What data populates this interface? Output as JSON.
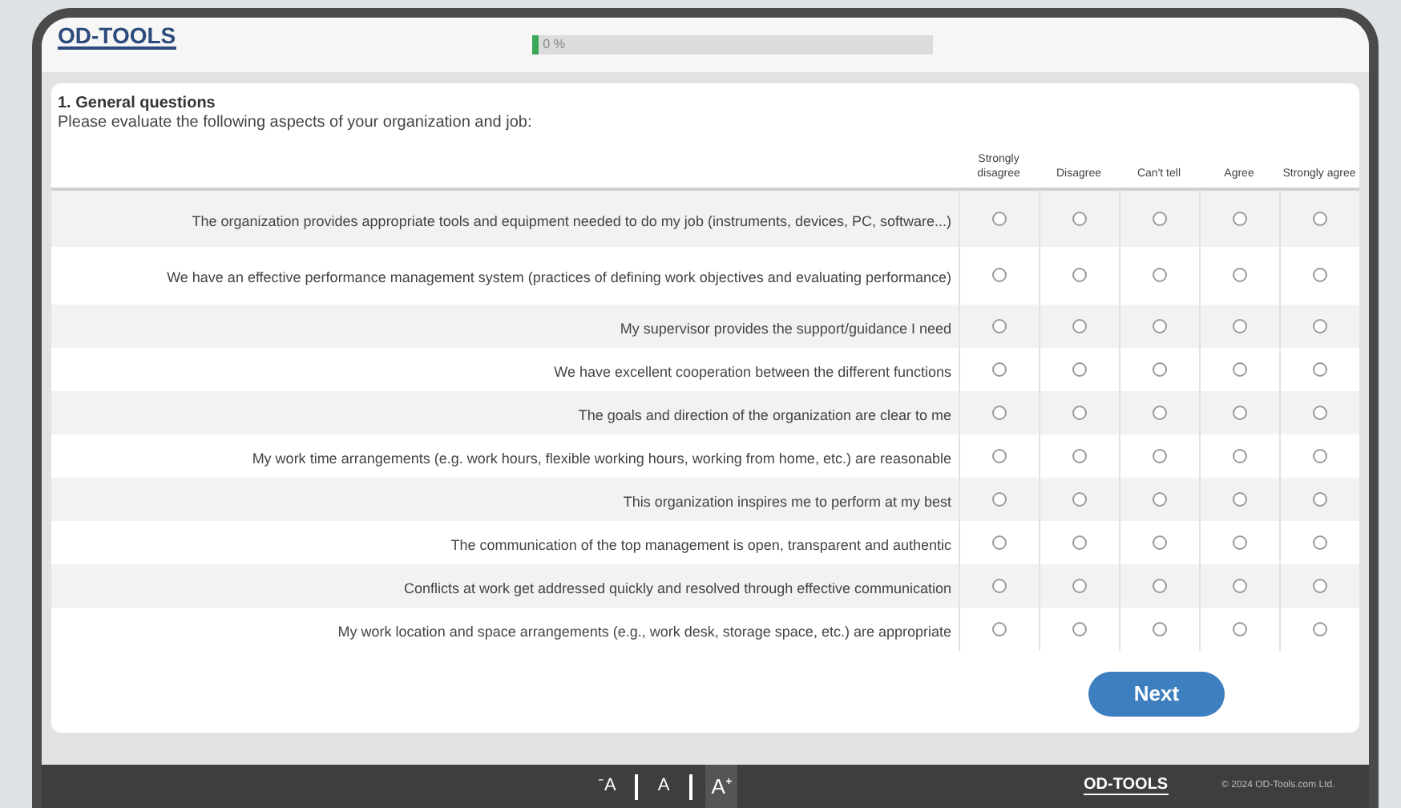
{
  "header": {
    "logo": "OD-TOOLS",
    "progress": {
      "level": 0,
      "label": "0 %"
    }
  },
  "section": {
    "title": "1. General questions",
    "instruction": "Please evaluate the following aspects of your organization and job:"
  },
  "table": {
    "columns": [
      "Strongly disagree",
      "Disagree",
      "Can't tell",
      "Agree",
      "Strongly agree"
    ],
    "rows": [
      {
        "question": "The organization provides appropriate tools and equipment needed to do my job (instruments, devices, PC, software...)",
        "choices": [
          {
            "selected": false
          },
          {
            "selected": false
          },
          {
            "selected": false
          },
          {
            "selected": false
          },
          {
            "selected": false
          }
        ]
      },
      {
        "question": "We have an effective performance management system (practices of defining work objectives and evaluating performance)",
        "choices": [
          {
            "selected": false
          },
          {
            "selected": false
          },
          {
            "selected": false
          },
          {
            "selected": false
          },
          {
            "selected": false
          }
        ]
      },
      {
        "question": "My supervisor provides the support/guidance I need",
        "choices": [
          {
            "selected": false
          },
          {
            "selected": false
          },
          {
            "selected": false
          },
          {
            "selected": false
          },
          {
            "selected": false
          }
        ]
      },
      {
        "question": "We have excellent cooperation between the different functions",
        "choices": [
          {
            "selected": false
          },
          {
            "selected": false
          },
          {
            "selected": false
          },
          {
            "selected": false
          },
          {
            "selected": false
          }
        ]
      },
      {
        "question": "The goals and direction of the organization are clear to me",
        "choices": [
          {
            "selected": false
          },
          {
            "selected": false
          },
          {
            "selected": false
          },
          {
            "selected": false
          },
          {
            "selected": false
          }
        ]
      },
      {
        "question": "My work time arrangements (e.g. work hours, flexible working hours, working from home, etc.) are reasonable",
        "choices": [
          {
            "selected": false
          },
          {
            "selected": false
          },
          {
            "selected": false
          },
          {
            "selected": false
          },
          {
            "selected": false
          }
        ]
      },
      {
        "question": "This organization inspires me to perform at my best",
        "choices": [
          {
            "selected": false
          },
          {
            "selected": false
          },
          {
            "selected": false
          },
          {
            "selected": false
          },
          {
            "selected": false
          }
        ]
      },
      {
        "question": "The communication of the top management is open, transparent and authentic",
        "choices": [
          {
            "selected": false
          },
          {
            "selected": false
          },
          {
            "selected": false
          },
          {
            "selected": false
          },
          {
            "selected": false
          }
        ]
      },
      {
        "question": "Conflicts at work get addressed quickly and resolved through effective communication",
        "choices": [
          {
            "selected": false
          },
          {
            "selected": false
          },
          {
            "selected": false
          },
          {
            "selected": false
          },
          {
            "selected": false
          }
        ]
      },
      {
        "question": "My work location and space arrangements (e.g., work desk, storage space, etc.) are appropriate",
        "choices": [
          {
            "selected": false
          },
          {
            "selected": false
          },
          {
            "selected": false
          },
          {
            "selected": false
          },
          {
            "selected": false
          }
        ]
      }
    ]
  },
  "next_button": "Next",
  "footer": {
    "font_sizes": [
      "⁻A",
      "A",
      "A⁺"
    ],
    "logo": "OD-TOOLS",
    "copyright": "© 2024 OD-Tools.com Ltd."
  }
}
